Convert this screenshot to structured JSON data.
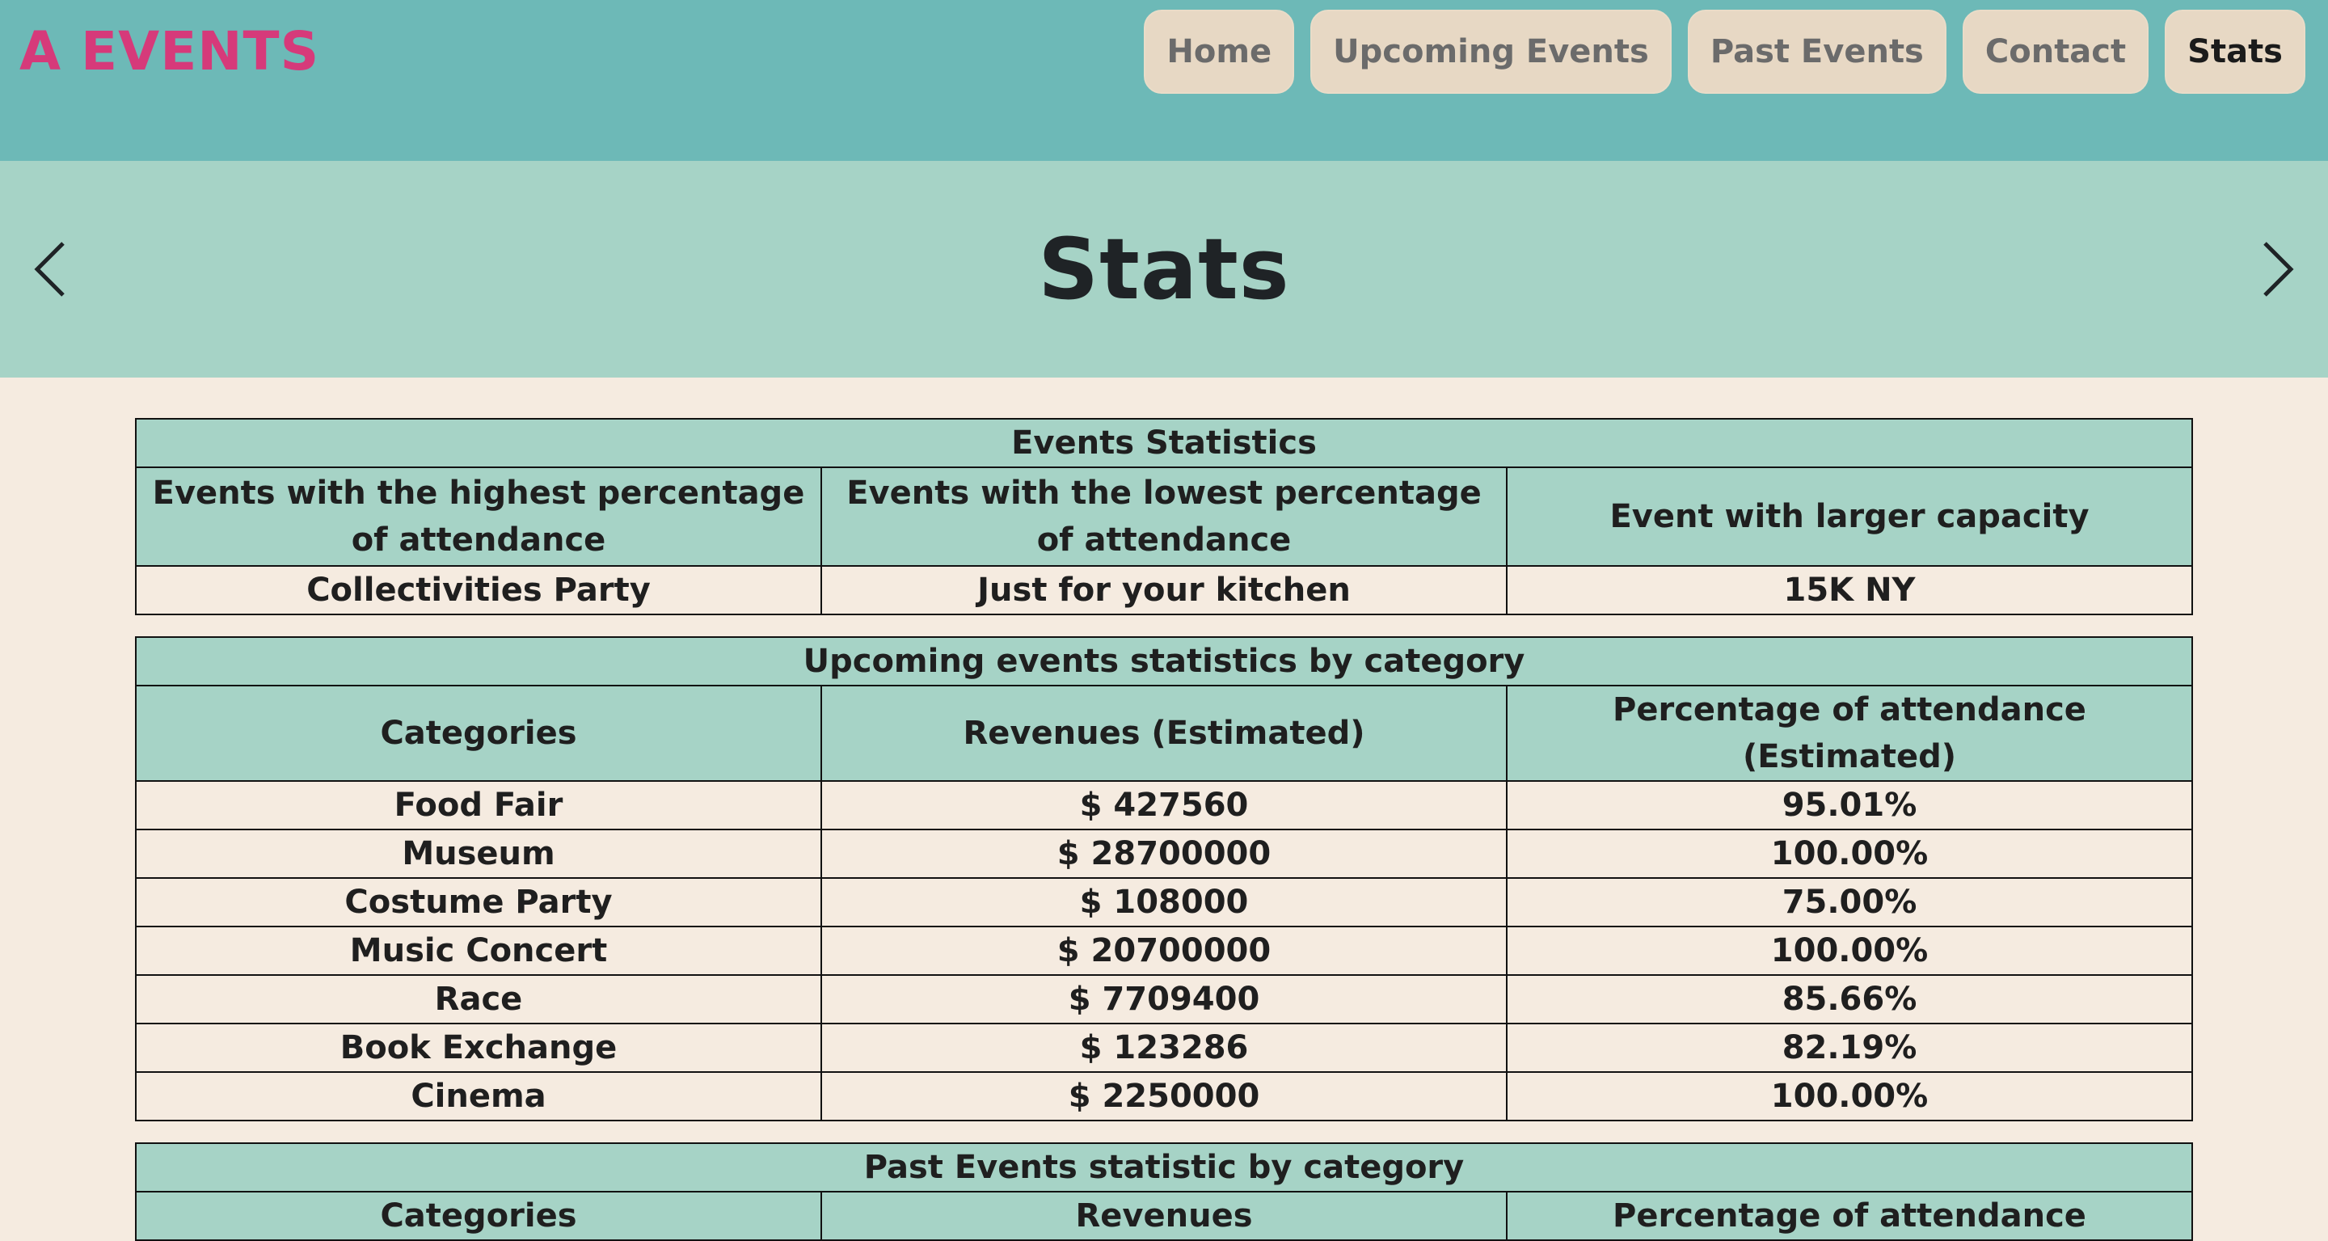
{
  "brand": {
    "logo_text": "A EVENTS",
    "accent": "#d63a7a"
  },
  "nav": {
    "items": [
      {
        "label": "Home"
      },
      {
        "label": "Upcoming Events"
      },
      {
        "label": "Past Events"
      },
      {
        "label": "Contact"
      },
      {
        "label": "Stats"
      }
    ],
    "active": "Stats"
  },
  "hero": {
    "title": "Stats",
    "prev_icon": "chevron-left-icon",
    "next_icon": "chevron-right-icon"
  },
  "events_stats": {
    "title": "Events Statistics",
    "headers": [
      "Events with the highest percentage of attendance",
      "Events with the lowest percentage of attendance",
      "Event with larger capacity"
    ],
    "row": [
      "Collectivities Party",
      "Just for your kitchen",
      "15K NY"
    ]
  },
  "upcoming_stats": {
    "title": "Upcoming events statistics by category",
    "headers": [
      "Categories",
      "Revenues (Estimated)",
      "Percentage of attendance (Estimated)"
    ],
    "rows": [
      [
        "Food Fair",
        "$ 427560",
        "95.01%"
      ],
      [
        "Museum",
        "$ 28700000",
        "100.00%"
      ],
      [
        "Costume Party",
        "$ 108000",
        "75.00%"
      ],
      [
        "Music Concert",
        "$ 20700000",
        "100.00%"
      ],
      [
        "Race",
        "$ 7709400",
        "85.66%"
      ],
      [
        "Book Exchange",
        "$ 123286",
        "82.19%"
      ],
      [
        "Cinema",
        "$ 2250000",
        "100.00%"
      ]
    ]
  },
  "past_stats": {
    "title": "Past Events statistic by category",
    "headers": [
      "Categories",
      "Revenues",
      "Percentage of attendance"
    ]
  },
  "colors": {
    "navbar": "#6db9b7",
    "hero": "#a6d3c6",
    "page_bg": "#f5ebe0",
    "button_bg": "#e7d8c4"
  }
}
